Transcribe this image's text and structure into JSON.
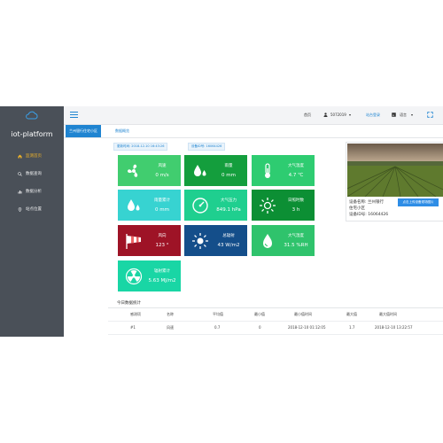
{
  "sidebar": {
    "brand": "iot-platform",
    "items": [
      {
        "label": "监测首页",
        "icon": "home-icon",
        "active": true
      },
      {
        "label": "数据查询",
        "icon": "search-icon",
        "active": false
      },
      {
        "label": "数据分析",
        "icon": "bar-chart-icon",
        "active": false
      },
      {
        "label": "站点位置",
        "icon": "map-pin-icon",
        "active": false
      }
    ]
  },
  "header": {
    "home": "首页",
    "user": "5072019",
    "station_link": "站台登录",
    "language": "语言",
    "fullscreen_icon": "fullscreen-icon"
  },
  "tabs": {
    "primary": "兰州银行住宅小区",
    "secondary": "数据概览"
  },
  "badges": {
    "update_time": "更新时间: 2018-12-10 16:43:26",
    "device_no": "设备ID号: 16064426"
  },
  "tiles": [
    {
      "label": "风速",
      "value": "0 m/s",
      "icon": "fan-icon",
      "color": "#41cd6f"
    },
    {
      "label": "雨量",
      "value": "0 mm",
      "icon": "raindrop-icon",
      "color": "#149e3d"
    },
    {
      "label": "大气温度",
      "value": "4.7 ℃",
      "icon": "thermometer-icon",
      "color": "#2ecc71"
    },
    {
      "label": "雨量累计",
      "value": "0 mm",
      "icon": "raindrops-icon",
      "color": "#37d3d1"
    },
    {
      "label": "大气压力",
      "value": "849.1 hPa",
      "icon": "gauge-icon",
      "color": "#1fcf8f"
    },
    {
      "label": "日照时数",
      "value": "3 h",
      "icon": "sun-icon",
      "color": "#0c8f34"
    },
    {
      "label": "风向",
      "value": "123 °",
      "icon": "windsock-icon",
      "color": "#9e1326"
    },
    {
      "label": "总辐射",
      "value": "43 W/m2",
      "icon": "sun-rays-icon",
      "color": "#144e8a"
    },
    {
      "label": "大气湿度",
      "value": "31.5 %RH",
      "icon": "humidity-icon",
      "color": "#2fc36c"
    },
    {
      "label": "辐射累计",
      "value": "5.63 MJ/m2",
      "icon": "radiation-icon",
      "color": "#19d6a5"
    }
  ],
  "device": {
    "name_label": "设备名称: 兰州银行",
    "address_label": "住宅小区",
    "id_label": "设备ID号: 16064426",
    "button": "点击上传设备现场图片"
  },
  "stats": {
    "title": "今日数据统计",
    "headers": [
      "感测项",
      "名称",
      "平均值",
      "最小值",
      "最小值时间",
      "最大值",
      "最大值时间"
    ],
    "rows": [
      [
        "#1",
        "风速",
        "0.7",
        "0",
        "2018-12-10 01:12:05",
        "1.7",
        "2018-12-10 13:22:57"
      ]
    ]
  }
}
